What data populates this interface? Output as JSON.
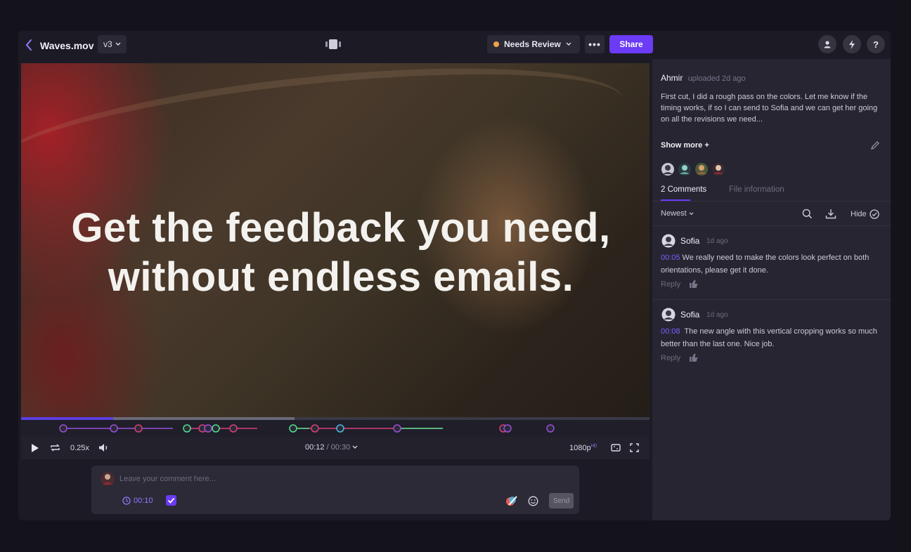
{
  "header": {
    "file_title": "Waves.mov",
    "version": "v3",
    "status": "Needs Review",
    "more": "•••",
    "share": "Share",
    "help": "?"
  },
  "video": {
    "headline_line1": "Get the feedback you need,",
    "headline_line2": "without endless emails.",
    "progress_fraction": 0.146,
    "buffer_fraction": 0.435
  },
  "player": {
    "speed": "0.25x",
    "current_time": "00:12",
    "duration": "/ 00:30",
    "quality": "1080p",
    "quality_badge": "HD"
  },
  "composer": {
    "placeholder": "Leave your comment here...",
    "timestamp": "00:10",
    "send": "Send"
  },
  "sidebar": {
    "owner_name": "Ahmir",
    "owner_meta": "uploaded 2d ago",
    "description": "First cut, I did a rough pass on the colors. Let me know if the timing works, if so I can send to Sofia and we can get her going on all the revisions we need...",
    "show_more": "Show more +",
    "tabs": [
      "2 Comments",
      "File information"
    ],
    "sort": "Newest",
    "hide": "Hide"
  },
  "comments": [
    {
      "author": "Sofia",
      "time": "1d ago",
      "timestamp": "00:05",
      "text": "We really need to make the colors look perfect on both orientations, please get it done.",
      "reply": "Reply"
    },
    {
      "author": "Sofia",
      "time": "1d ago",
      "timestamp": "00:08",
      "text": "The new angle with this vertical cropping works so much better than the last one. Nice job.",
      "reply": "Reply"
    }
  ],
  "colors": {
    "accent": "#6b3bf5",
    "status_dot": "#f0a04a",
    "timestamp": "#7b61ff"
  }
}
